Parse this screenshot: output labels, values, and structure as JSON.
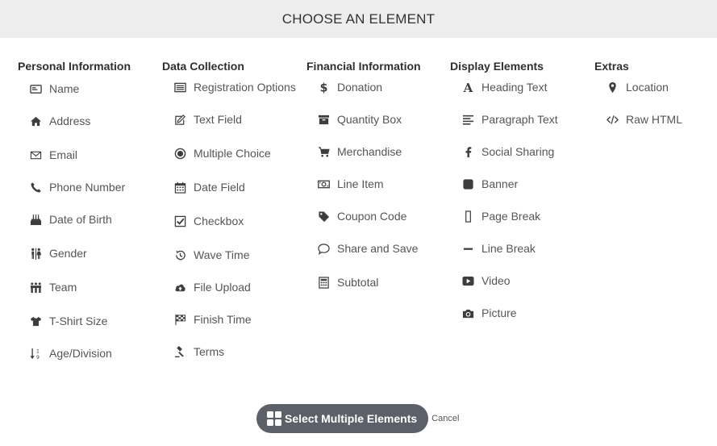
{
  "header": {
    "title": "CHOOSE AN ELEMENT"
  },
  "columns": [
    {
      "heading": "Personal Information",
      "items": [
        {
          "label": "Name",
          "icon": "id-card-icon"
        },
        {
          "label": "Address",
          "icon": "home-icon"
        },
        {
          "label": "Email",
          "icon": "envelope-icon"
        },
        {
          "label": "Phone Number",
          "icon": "phone-icon"
        },
        {
          "label": "Date of Birth",
          "icon": "birthday-cake-icon"
        },
        {
          "label": "Gender",
          "icon": "male-female-icon"
        },
        {
          "label": "Team",
          "icon": "team-icon"
        },
        {
          "label": "T-Shirt Size",
          "icon": "tshirt-icon"
        },
        {
          "label": "Age/Division",
          "icon": "sort-numeric-icon"
        }
      ]
    },
    {
      "heading": "Data Collection",
      "items": [
        {
          "label": "Registration Options",
          "icon": "list-icon"
        },
        {
          "label": "Text Field",
          "icon": "edit-icon"
        },
        {
          "label": "Multiple Choice",
          "icon": "radio-icon"
        },
        {
          "label": "Date Field",
          "icon": "calendar-icon"
        },
        {
          "label": "Checkbox",
          "icon": "checkbox-icon"
        },
        {
          "label": "Wave Time",
          "icon": "history-icon"
        },
        {
          "label": "File Upload",
          "icon": "cloud-upload-icon"
        },
        {
          "label": "Finish Time",
          "icon": "checkered-flag-icon"
        },
        {
          "label": "Terms",
          "icon": "gavel-icon"
        }
      ]
    },
    {
      "heading": "Financial Information",
      "items": [
        {
          "label": "Donation",
          "icon": "dollar-icon"
        },
        {
          "label": "Quantity Box",
          "icon": "archive-icon"
        },
        {
          "label": "Merchandise",
          "icon": "shopping-cart-icon"
        },
        {
          "label": "Line Item",
          "icon": "money-bill-icon"
        },
        {
          "label": "Coupon Code",
          "icon": "tag-icon"
        },
        {
          "label": "Share and Save",
          "icon": "comment-icon"
        },
        {
          "label": "Subtotal",
          "icon": "calculator-icon"
        }
      ]
    },
    {
      "heading": "Display Elements",
      "items": [
        {
          "label": "Heading Text",
          "icon": "font-icon"
        },
        {
          "label": "Paragraph Text",
          "icon": "align-left-icon"
        },
        {
          "label": "Social Sharing",
          "icon": "facebook-icon"
        },
        {
          "label": "Banner",
          "icon": "square-icon"
        },
        {
          "label": "Page Break",
          "icon": "page-break-icon"
        },
        {
          "label": "Line Break",
          "icon": "minus-icon"
        },
        {
          "label": "Video",
          "icon": "play-icon"
        },
        {
          "label": "Picture",
          "icon": "camera-icon"
        }
      ]
    },
    {
      "heading": "Extras",
      "items": [
        {
          "label": "Location",
          "icon": "map-marker-icon"
        },
        {
          "label": "Raw HTML",
          "icon": "code-icon"
        }
      ]
    }
  ],
  "footer": {
    "multi_select_label": "Select Multiple Elements",
    "cancel_label": "Cancel"
  }
}
